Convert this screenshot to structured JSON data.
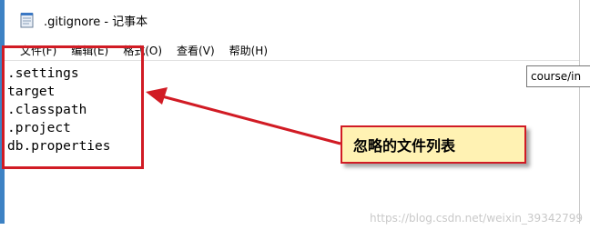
{
  "window": {
    "title": ".gitignore - 记事本"
  },
  "menu": {
    "items": [
      "文件(F)",
      "编辑(E)",
      "格式(O)",
      "查看(V)",
      "帮助(H)"
    ]
  },
  "editor": {
    "lines": [
      ".settings",
      "target",
      ".classpath",
      ".project",
      "db.properties"
    ]
  },
  "tooltip": {
    "text": "course/in"
  },
  "annotation": {
    "callout_text": "忽略的文件列表",
    "color": "#d11b24",
    "callout_bg": "#fff2b3"
  },
  "watermark": {
    "text": "https://blog.csdn.net/weixin_39342799"
  }
}
